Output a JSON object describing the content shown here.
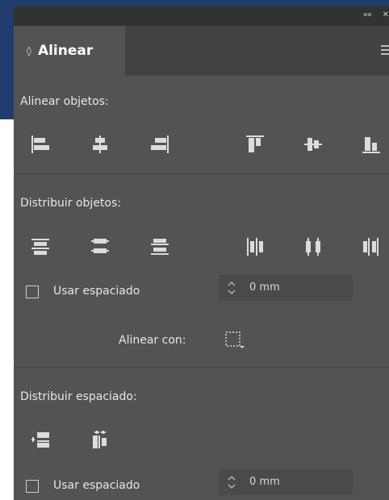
{
  "panel": {
    "tab_label": "Alinear",
    "collapse_glyph": "««",
    "close_glyph": "✕"
  },
  "sections": {
    "align_objects": "Alinear objetos:",
    "distribute_objects": "Distribuir objetos:",
    "distribute_spacing": "Distribuir espaciado:"
  },
  "distribute_objects_spacing": {
    "checkbox_label": "Usar espaciado",
    "checked": false,
    "value": "0 mm"
  },
  "align_with": {
    "label": "Alinear con:",
    "icon": "selection-icon"
  },
  "distribute_spacing_controls": {
    "checkbox_label": "Usar espaciado",
    "checked": false,
    "value": "0 mm"
  },
  "colors": {
    "panel_bg": "#535353",
    "titlebar_bg": "#323232",
    "backdrop": "#1e3c6e"
  }
}
